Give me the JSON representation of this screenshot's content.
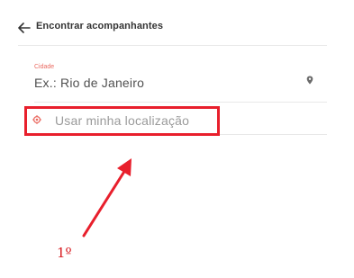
{
  "header": {
    "back_icon": "arrow-left-icon",
    "title": "Encontrar acompanhantes"
  },
  "city_field": {
    "label": "Cidade",
    "placeholder": "Ex.: Rio de Janeiro",
    "icon": "map-pin-icon"
  },
  "location_option": {
    "icon": "location-target-icon",
    "label": "Usar minha localização"
  },
  "annotation": {
    "step_label": "1º",
    "highlight_color": "#e81f2c",
    "arrow_color": "#e81f2c",
    "label_color": "#d7191f"
  },
  "colors": {
    "accent": "#ea6b62",
    "text_dark": "#333333",
    "text_muted": "#9a9a9a",
    "divider": "#e8e8e8"
  }
}
